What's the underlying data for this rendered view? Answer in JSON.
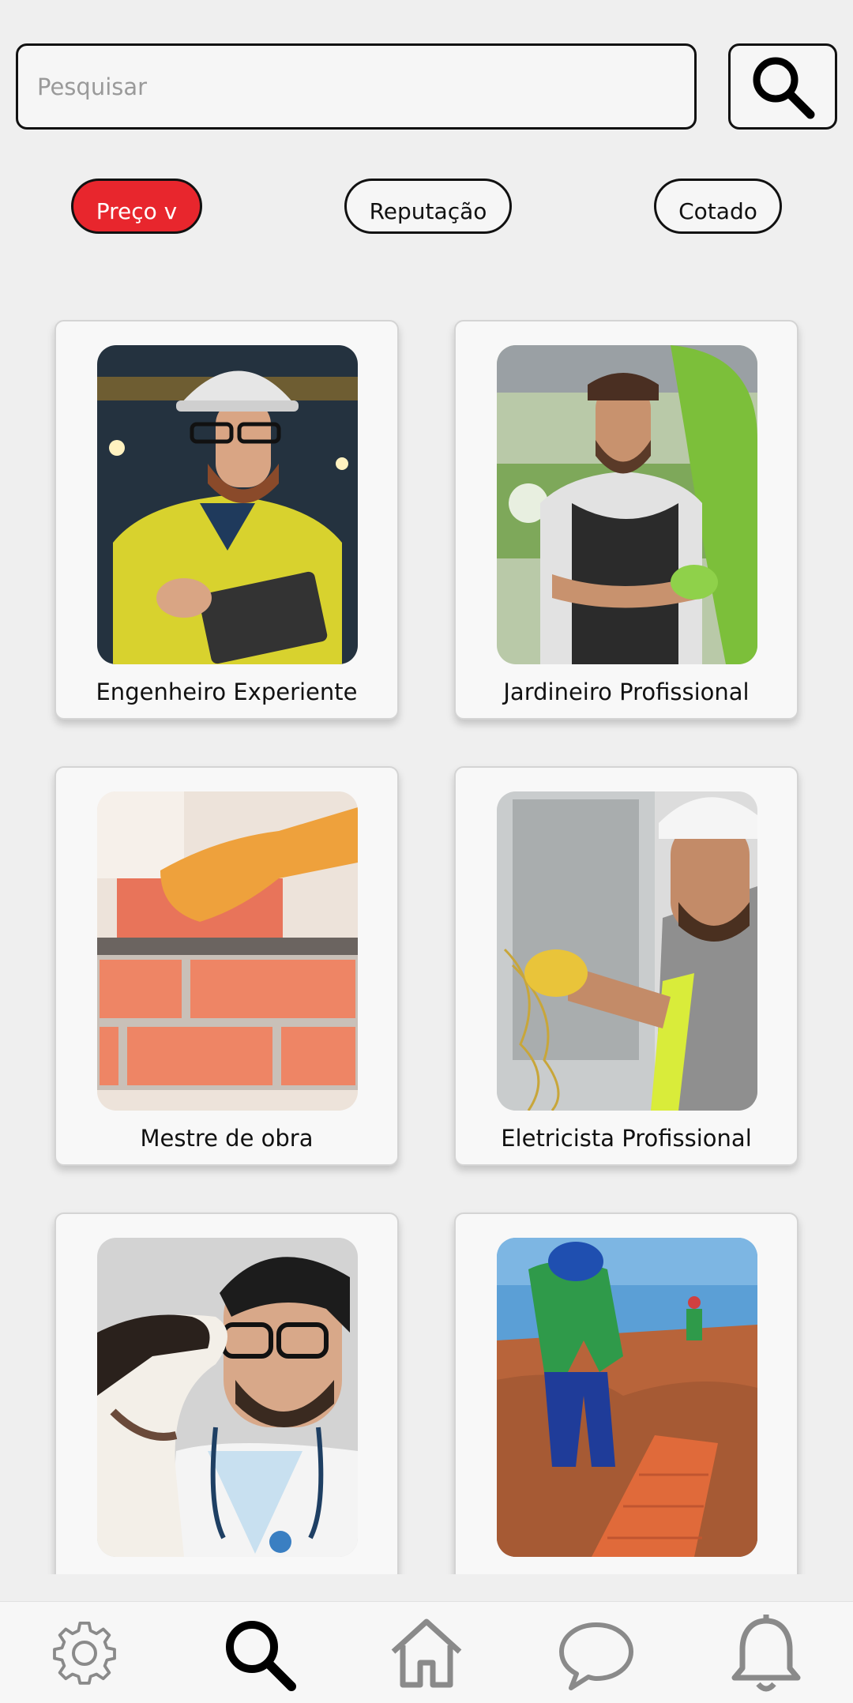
{
  "search": {
    "placeholder": "Pesquisar",
    "button_icon": "search-icon"
  },
  "filters": [
    {
      "label": "Preço v",
      "active": true
    },
    {
      "label": "Reputação",
      "active": false
    },
    {
      "label": "Cotado",
      "active": false
    }
  ],
  "cards": [
    {
      "label": "Engenheiro Experiente"
    },
    {
      "label": "Jardineiro Profissional"
    },
    {
      "label": "Mestre de obra"
    },
    {
      "label": "Eletricista Profissional"
    },
    {
      "label": ""
    },
    {
      "label": ""
    }
  ],
  "bottom_nav": [
    {
      "icon": "gear-icon",
      "active": false
    },
    {
      "icon": "search-icon",
      "active": true
    },
    {
      "icon": "home-icon",
      "active": false
    },
    {
      "icon": "chat-icon",
      "active": false
    },
    {
      "icon": "bell-icon",
      "active": false
    }
  ],
  "colors": {
    "accent": "#e8262d",
    "background": "#efefef",
    "nav_inactive": "#8a8a8a",
    "nav_active": "#111111"
  }
}
